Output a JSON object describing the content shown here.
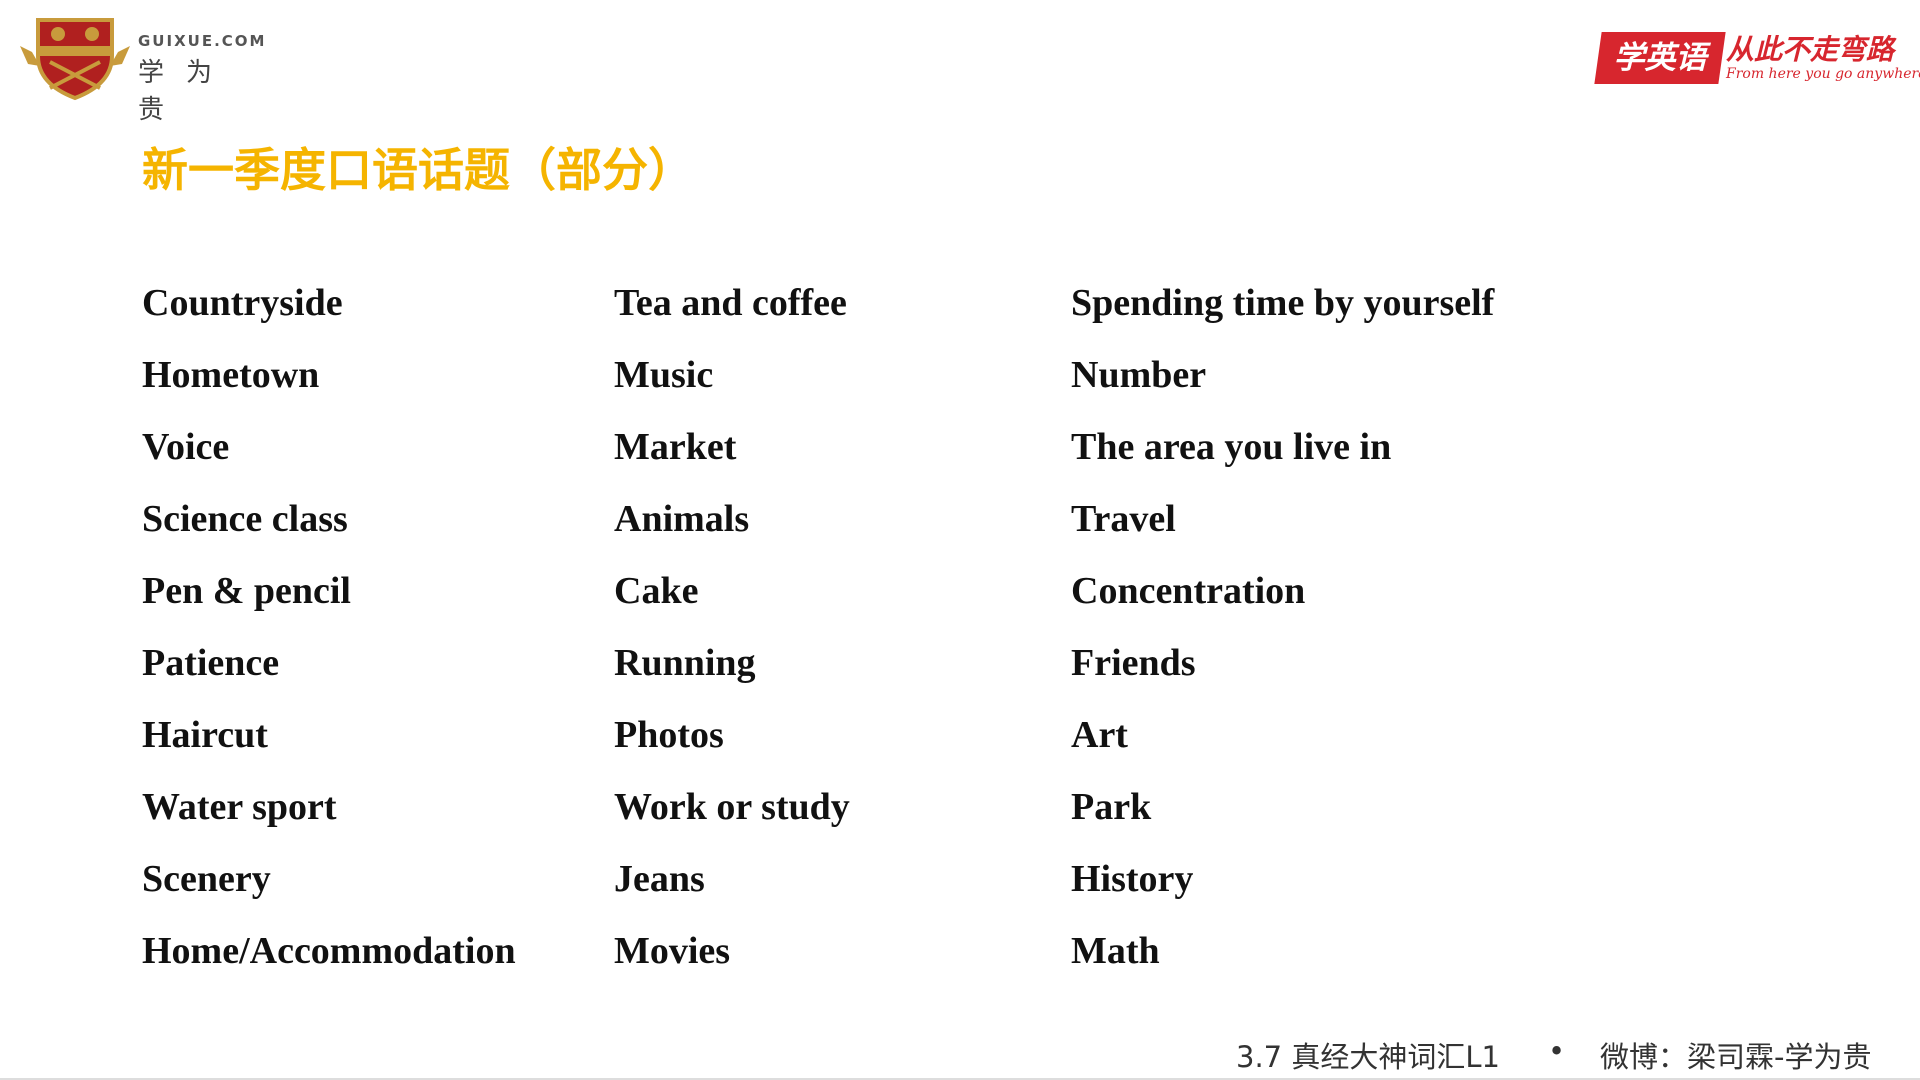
{
  "header": {
    "logo_left": {
      "domain": "GUIXUE.COM",
      "brand": "学为贵"
    },
    "logo_right": {
      "badge": "学英语",
      "slogan_cn": "从此不走弯路",
      "slogan_en": "From here you go anywhere."
    }
  },
  "title": "新一季度口语话题（部分）",
  "topics": {
    "column_1": [
      "Countryside",
      "Hometown",
      "Voice",
      "Science class",
      "Pen & pencil",
      "Patience",
      "Haircut",
      "Water sport",
      "Scenery",
      "Home/Accommodation"
    ],
    "column_2": [
      "Tea and coffee",
      "Music",
      "Market",
      "Animals",
      "Cake",
      "Running",
      "Photos",
      "Work or study",
      "Jeans",
      "Movies"
    ],
    "column_3": [
      "Spending time by yourself",
      "Number",
      "The area you live in",
      "Travel",
      "Concentration",
      "Friends",
      "Art",
      "Park",
      "History",
      "Math"
    ]
  },
  "footer": {
    "course": "3.7 真经大神词汇L1",
    "bullet": "•",
    "weibo": "微博：梁司霖-学为贵"
  },
  "colors": {
    "title": "#f5b400",
    "brand_red": "#d7262e",
    "crest_red": "#b0201f",
    "crest_gold": "#c89b3c"
  }
}
